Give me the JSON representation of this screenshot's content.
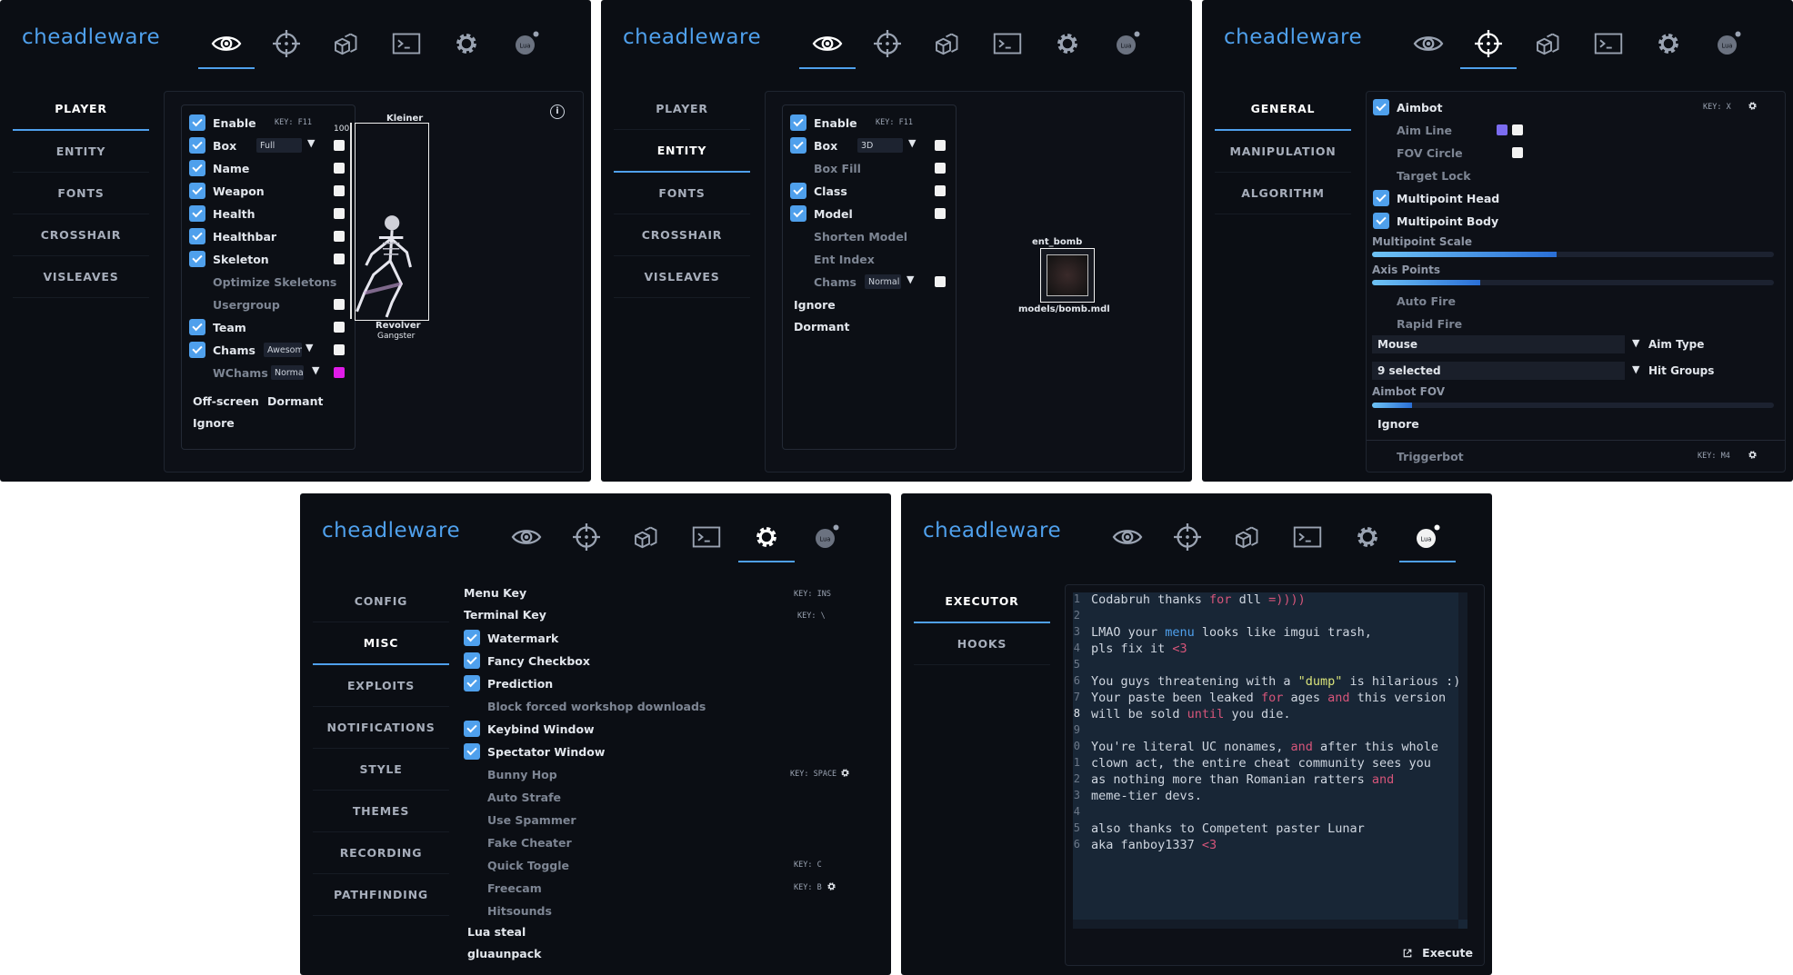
{
  "brand": "cheadleware",
  "colors": {
    "accent": "#4fa0ec",
    "background": "#0b0e14",
    "code_bg": "#182636",
    "keyword": "#d6557a",
    "string": "#d9e27a",
    "magenta": "#e01ce8",
    "purple": "#7b6cf0"
  },
  "tab_icons": [
    "eye-icon",
    "crosshair-icon",
    "cubes-icon",
    "terminal-icon",
    "gear-icon",
    "lua-icon"
  ],
  "tab_lua_label": "Lua",
  "visuals_player": {
    "nav": [
      "PLAYER",
      "ENTITY",
      "FONTS",
      "CROSSHAIR",
      "VISLEAVES"
    ],
    "key": "KEY: F11",
    "options": [
      "Enable",
      "Box",
      "Name",
      "Weapon",
      "Health",
      "Healthbar",
      "Skeleton",
      "Optimize Skeletons",
      "Usergroup",
      "Team",
      "Chams",
      "WChams"
    ],
    "box_value": "Full",
    "chams_value": "Awesome",
    "wchams_value": "Normal",
    "extra": [
      "Off-screen",
      "Dormant",
      "Ignore"
    ],
    "preview": {
      "name": "Kleiner",
      "health": "100",
      "weapon": "Revolver",
      "group": "Gangster"
    }
  },
  "visuals_entity": {
    "nav": [
      "PLAYER",
      "ENTITY",
      "FONTS",
      "CROSSHAIR",
      "VISLEAVES"
    ],
    "key": "KEY: F11",
    "options": [
      "Enable",
      "Box",
      "Box Fill",
      "Class",
      "Model",
      "Shorten Model",
      "Ent Index",
      "Chams"
    ],
    "box_value": "3D",
    "chams_value": "Normal",
    "extra": [
      "Ignore",
      "Dormant"
    ],
    "preview": {
      "class": "ent_bomb",
      "model": "models/bomb.mdl"
    }
  },
  "aimbot": {
    "nav": [
      "GENERAL",
      "MANIPULATION",
      "ALGORITHM"
    ],
    "key": "KEY: X",
    "options": [
      "Aimbot",
      "Aim Line",
      "FOV Circle",
      "Target Lock",
      "Multipoint Head",
      "Multipoint Body"
    ],
    "sliders": [
      {
        "label": "Multipoint Scale",
        "value": 0.46
      },
      {
        "label": "Axis Points",
        "value": 0.27
      }
    ],
    "fire": [
      "Auto Fire",
      "Rapid Fire"
    ],
    "aim_type": {
      "label": "Aim Type",
      "value": "Mouse"
    },
    "hit_groups": {
      "label": "Hit Groups",
      "value": "9 selected"
    },
    "fov": {
      "label": "Aimbot FOV",
      "value": 0.1
    },
    "ignore": "Ignore",
    "triggerbot": "Triggerbot",
    "trigger_key": "KEY: M4"
  },
  "settings": {
    "nav": [
      "CONFIG",
      "MISC",
      "EXPLOITS",
      "NOTIFICATIONS",
      "STYLE",
      "THEMES",
      "RECORDING",
      "PATHFINDING"
    ],
    "menu_key": {
      "label": "Menu Key",
      "key": "KEY: INS"
    },
    "terminal_key": {
      "label": "Terminal Key",
      "key": "KEY: \\"
    },
    "options": [
      "Watermark",
      "Fancy Checkbox",
      "Prediction",
      "Block forced workshop downloads",
      "Keybind Window",
      "Spectator Window",
      "Bunny Hop",
      "Auto Strafe",
      "Use Spammer",
      "Fake Cheater",
      "Quick Toggle",
      "Freecam",
      "Hitsounds"
    ],
    "bhop_key": "KEY: SPACE",
    "quick_key": "KEY: C",
    "freecam_key": "KEY: B",
    "extra": [
      "Lua steal",
      "gluaunpack"
    ]
  },
  "lua": {
    "nav": [
      "EXECUTOR",
      "HOOKS"
    ],
    "line_numbers": [
      "1",
      "2",
      "3",
      "4",
      "5",
      "6",
      "7",
      "8",
      "9",
      "0",
      "1",
      "2",
      "3",
      "4",
      "5",
      "6"
    ],
    "code": {
      "l1a": "Codabruh thanks ",
      "l1k": "for",
      "l1b": " dll ",
      "l1c": "=))))",
      "l3a": "LMAO your ",
      "l3f": "menu",
      "l3b": " looks like imgui trash,",
      "l4a": "pls fix it ",
      "l4n": "<3",
      "l6a": "You guys threatening with a ",
      "l6s": "\"dump\"",
      "l6b": " is hilarious :)",
      "l7a": "Your paste been leaked ",
      "l7k": "for",
      "l7b": " ages ",
      "l7k2": "and",
      "l7c": " this version",
      "l8a": "will be sold ",
      "l8k": "until",
      "l8b": " you die.",
      "l10a": "You're literal UC nonames, ",
      "l10k": "and",
      "l10b": " after this whole",
      "l11": "clown act, the entire cheat community sees you",
      "l12a": "as nothing more than Romanian ratters ",
      "l12k": "and",
      "l13": "meme-tier devs.",
      "l15": "also thanks to Competent paster Lunar",
      "l16a": "aka fanboy1337 ",
      "l16n": "<3"
    },
    "execute": "Execute"
  }
}
